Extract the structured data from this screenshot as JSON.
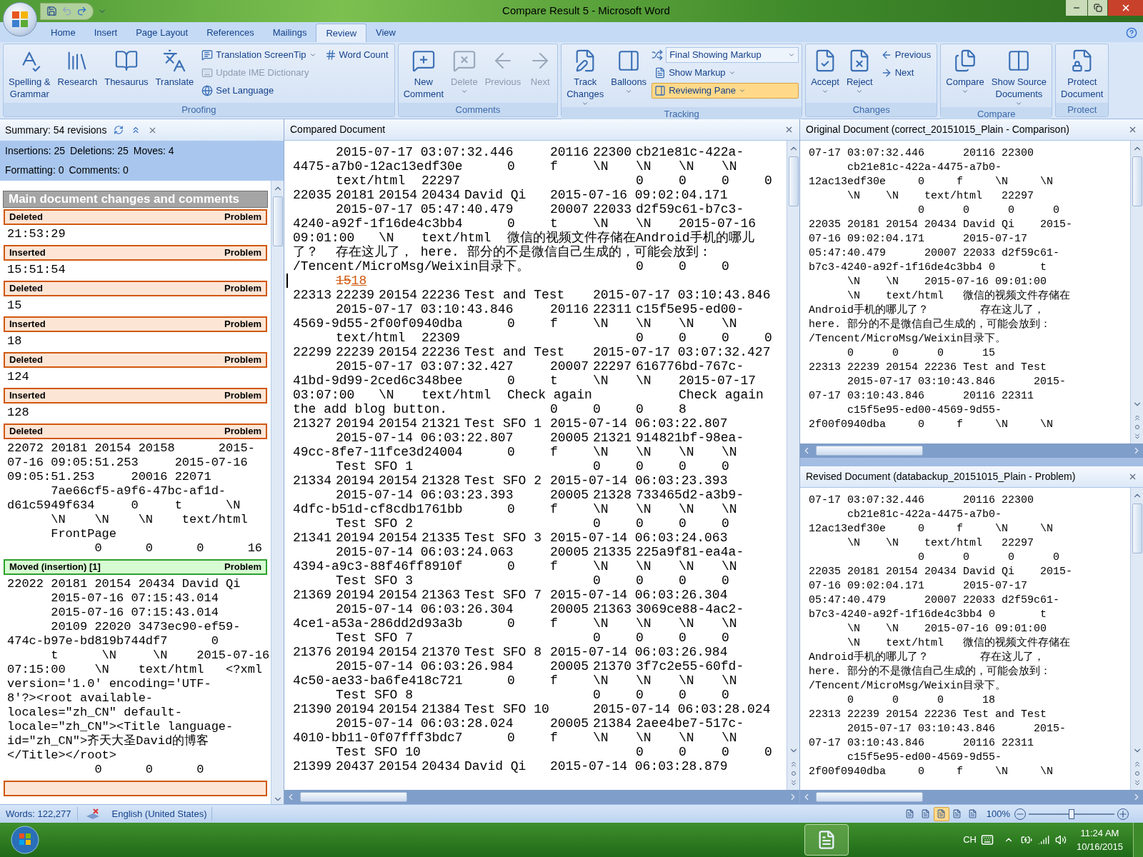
{
  "window": {
    "title": "Compare Result 5 - Microsoft Word"
  },
  "ribbon_tabs": [
    {
      "label": "Home",
      "selected": false
    },
    {
      "label": "Insert",
      "selected": false
    },
    {
      "label": "Page Layout",
      "selected": false
    },
    {
      "label": "References",
      "selected": false
    },
    {
      "label": "Mailings",
      "selected": false
    },
    {
      "label": "Review",
      "selected": true
    },
    {
      "label": "View",
      "selected": false
    }
  ],
  "ribbon_groups": [
    {
      "label": "Proofing",
      "controls": [
        {
          "kind": "large",
          "lines": [
            "Spelling &",
            "Grammar"
          ],
          "menu": false,
          "disabled": false
        },
        {
          "kind": "large",
          "lines": [
            "Research"
          ],
          "menu": false,
          "disabled": false
        },
        {
          "kind": "large",
          "lines": [
            "Thesaurus"
          ],
          "menu": false,
          "disabled": false
        },
        {
          "kind": "large",
          "lines": [
            "Translate"
          ],
          "menu": false,
          "disabled": false
        },
        {
          "kind": "stack",
          "items": [
            {
              "kind": "button",
              "label": "Translation ScreenTip",
              "menu": true,
              "disabled": false,
              "pressed": false
            },
            {
              "kind": "button",
              "label": "Update IME Dictionary",
              "menu": false,
              "disabled": true,
              "pressed": false
            },
            {
              "kind": "button",
              "label": "Set Language",
              "menu": false,
              "disabled": false,
              "pressed": false
            }
          ]
        },
        {
          "kind": "stack",
          "items": [
            {
              "kind": "button",
              "label": "Word Count",
              "menu": false,
              "disabled": false,
              "pressed": false
            }
          ]
        }
      ]
    },
    {
      "label": "Comments",
      "controls": [
        {
          "kind": "large",
          "lines": [
            "New",
            "Comment"
          ],
          "menu": false,
          "disabled": false
        },
        {
          "kind": "large",
          "lines": [
            "Delete"
          ],
          "menu": true,
          "disabled": true
        },
        {
          "kind": "large",
          "lines": [
            "Previous"
          ],
          "menu": false,
          "disabled": true
        },
        {
          "kind": "large",
          "lines": [
            "Next"
          ],
          "menu": false,
          "disabled": true
        }
      ]
    },
    {
      "label": "Tracking",
      "controls": [
        {
          "kind": "large",
          "lines": [
            "Track",
            "Changes"
          ],
          "menu": true,
          "disabled": false
        },
        {
          "kind": "large",
          "lines": [
            "Balloons"
          ],
          "menu": true,
          "disabled": false
        },
        {
          "kind": "stack",
          "items": [
            {
              "kind": "combo",
              "label": "Final Showing Markup",
              "menu": true,
              "disabled": false,
              "pressed": false
            },
            {
              "kind": "button",
              "label": "Show Markup",
              "menu": true,
              "disabled": false,
              "pressed": false
            },
            {
              "kind": "button",
              "label": "Reviewing Pane",
              "menu": true,
              "disabled": false,
              "pressed": true
            }
          ]
        }
      ]
    },
    {
      "label": "Changes",
      "controls": [
        {
          "kind": "large",
          "lines": [
            "Accept"
          ],
          "menu": true,
          "disabled": false
        },
        {
          "kind": "large",
          "lines": [
            "Reject"
          ],
          "menu": true,
          "disabled": false
        },
        {
          "kind": "stack",
          "items": [
            {
              "kind": "button",
              "label": "Previous",
              "menu": false,
              "disabled": false,
              "pressed": false
            },
            {
              "kind": "button",
              "label": "Next",
              "menu": false,
              "disabled": false,
              "pressed": false
            }
          ]
        }
      ]
    },
    {
      "label": "Compare",
      "controls": [
        {
          "kind": "large",
          "lines": [
            "Compare"
          ],
          "menu": true,
          "disabled": false
        },
        {
          "kind": "large",
          "lines": [
            "Show Source",
            "Documents"
          ],
          "menu": true,
          "disabled": false
        }
      ]
    },
    {
      "label": "Protect",
      "controls": [
        {
          "kind": "large",
          "lines": [
            "Protect",
            "Document"
          ],
          "menu": false,
          "disabled": false
        }
      ]
    }
  ],
  "reviewing_pane": {
    "summary": "Summary: 54 revisions",
    "counts": [
      [
        "Insertions: 25",
        "Deletions: 25",
        "Moves: 4"
      ],
      [
        "Formatting: 0",
        "Comments: 0"
      ]
    ],
    "section_heading": "Main document changes and comments",
    "revisions": [
      {
        "kind": "deleted",
        "label": "Deleted",
        "author": "Problem",
        "lines": [
          "21:53:29"
        ]
      },
      {
        "kind": "inserted",
        "label": "Inserted",
        "author": "Problem",
        "lines": [
          "15:51:54"
        ]
      },
      {
        "kind": "deleted",
        "label": "Deleted",
        "author": "Problem",
        "lines": [
          "15"
        ]
      },
      {
        "kind": "inserted",
        "label": "Inserted",
        "author": "Problem",
        "lines": [
          "18"
        ]
      },
      {
        "kind": "deleted",
        "label": "Deleted",
        "author": "Problem",
        "lines": [
          "124"
        ]
      },
      {
        "kind": "inserted",
        "label": "Inserted",
        "author": "Problem",
        "lines": [
          "128"
        ]
      },
      {
        "kind": "deleted",
        "label": "Deleted",
        "author": "Problem",
        "lines": [
          "22072 20181 20154 20158      2015-",
          "07-16 09:05:51.253     2015-07-16",
          "09:05:51.253     20016 22071",
          "      7ae66cf5-a9f6-47bc-af1d-",
          "d61c5949f634     0     t      \\N",
          "      \\N    \\N    \\N    text/html",
          "      FrontPage",
          "            0      0      0      16"
        ]
      },
      {
        "kind": "moved",
        "label": "Moved (insertion) [1]",
        "author": "Problem",
        "lines": [
          "22022 20181 20154 20434 David Qi",
          "      2015-07-16 07:15:43.014",
          "      2015-07-16 07:15:43.014",
          "      20109 22020 3473ec90-ef59-",
          "474c-b97e-bd819b744df7      0",
          "      t      \\N     \\N    2015-07-16",
          "07:15:00    \\N    text/html   <?xml",
          "version='1.0' encoding='UTF-",
          "8'?><root available-",
          "locales=\"zh_CN\" default-",
          "locale=\"zh_CN\"><Title language-",
          "id=\"zh_CN\">齐天大圣David的博客",
          "</Title></root>",
          "            0      0      0"
        ]
      },
      {
        "kind": "inserted"
      }
    ]
  },
  "compared_document": {
    "title": "Compared Document",
    "lines": [
      {
        "kind": "text",
        "text": "\t2015-07-17 03:07:32.446\t20116\t22300\tcb21e81c-422a-"
      },
      {
        "kind": "text",
        "text": "4475-a7b0-12ac13edf30e\t0\tf\t\\N\t\\N\t\\N\t\\N"
      },
      {
        "kind": "text",
        "text": "\ttext/html\t22297\t\t\t\t\t0\t0\t0\t0"
      },
      {
        "kind": "text",
        "text": "22035\t20181\t20154\t20434\tDavid Qi\t2015-07-16 09:02:04.171"
      },
      {
        "kind": "text",
        "text": "\t2015-07-17 05:47:40.479\t20007\t22033\td2f59c61-b7c3-"
      },
      {
        "kind": "text",
        "text": "4240-a92f-1f16de4c3bb4\t0\tt\t\\N\t\\N\t2015-07-16"
      },
      {
        "kind": "text",
        "text": "09:01:00\t\\N\ttext/html\t微信的视频文件存储在Android手机的哪儿"
      },
      {
        "kind": "text",
        "text": "了？\t存在这儿了， here. 部分的不是微信自己生成的，可能会放到："
      },
      {
        "kind": "text",
        "text": "/Tencent/MicroMsg/Weixin目录下。\t\t\t0\t0\t0"
      },
      {
        "kind": "revision",
        "deleted": "15",
        "inserted": "18"
      },
      {
        "kind": "text",
        "text": "22313\t22239\t20154\t22236\tTest and Test\t2015-07-17 03:10:43.846"
      },
      {
        "kind": "text",
        "text": "\t2015-07-17 03:10:43.846\t20116\t22311\tc15f5e95-ed00-"
      },
      {
        "kind": "text",
        "text": "4569-9d55-2f00f0940dba\t0\tf\t\\N\t\\N\t\\N\t\\N"
      },
      {
        "kind": "text",
        "text": "\ttext/html\t22309\t\t\t\t\t0\t0\t0\t0"
      },
      {
        "kind": "text",
        "text": "22299\t22239\t20154\t22236\tTest and Test\t2015-07-17 03:07:32.427"
      },
      {
        "kind": "text",
        "text": "\t2015-07-17 03:07:32.427\t20007\t22297\t616776bd-767c-"
      },
      {
        "kind": "text",
        "text": "41bd-9d99-2ced6c348bee\t0\tt\t\\N\t\\N\t2015-07-17"
      },
      {
        "kind": "text",
        "text": "03:07:00\t\\N\ttext/html\tCheck again\t\tCheck again"
      },
      {
        "kind": "text",
        "text": "the add blog button.\t\t\t0\t0\t0\t8"
      },
      {
        "kind": "text",
        "text": "21327\t20194\t20154\t21321\tTest SFO 1\t2015-07-14 06:03:22.807"
      },
      {
        "kind": "text",
        "text": "\t2015-07-14 06:03:22.807\t20005\t21321\t914821bf-98ea-"
      },
      {
        "kind": "text",
        "text": "49cc-8fe7-11fce3d24004\t0\tf\t\\N\t\\N\t\\N\t\\N"
      },
      {
        "kind": "text",
        "text": "\tTest SFO 1\t\t\t\t\t0\t0\t0\t0"
      },
      {
        "kind": "text",
        "text": "21334\t20194\t20154\t21328\tTest SFO 2\t2015-07-14 06:03:23.393"
      },
      {
        "kind": "text",
        "text": "\t2015-07-14 06:03:23.393\t20005\t21328\t733465d2-a3b9-"
      },
      {
        "kind": "text",
        "text": "4dfc-b51d-cf8cdb1761bb\t0\tf\t\\N\t\\N\t\\N\t\\N"
      },
      {
        "kind": "text",
        "text": "\tTest SFO 2\t\t\t\t\t0\t0\t0\t0"
      },
      {
        "kind": "text",
        "text": "21341\t20194\t20154\t21335\tTest SFO 3\t2015-07-14 06:03:24.063"
      },
      {
        "kind": "text",
        "text": "\t2015-07-14 06:03:24.063\t20005\t21335\t225a9f81-ea4a-"
      },
      {
        "kind": "text",
        "text": "4394-a9c3-88f46ff8910f\t0\tf\t\\N\t\\N\t\\N\t\\N"
      },
      {
        "kind": "text",
        "text": "\tTest SFO 3\t\t\t\t\t0\t0\t0\t0"
      },
      {
        "kind": "text",
        "text": "21369\t20194\t20154\t21363\tTest SFO 7\t2015-07-14 06:03:26.304"
      },
      {
        "kind": "text",
        "text": "\t2015-07-14 06:03:26.304\t20005\t21363\t3069ce88-4ac2-"
      },
      {
        "kind": "text",
        "text": "4ce1-a53a-286dd2d93a3b\t0\tf\t\\N\t\\N\t\\N\t\\N"
      },
      {
        "kind": "text",
        "text": "\tTest SFO 7\t\t\t\t\t0\t0\t0\t0"
      },
      {
        "kind": "text",
        "text": "21376\t20194\t20154\t21370\tTest SFO 8\t2015-07-14 06:03:26.984"
      },
      {
        "kind": "text",
        "text": "\t2015-07-14 06:03:26.984\t20005\t21370\t3f7c2e55-60fd-"
      },
      {
        "kind": "text",
        "text": "4c50-ae33-ba6fe418c721\t0\tf\t\\N\t\\N\t\\N\t\\N"
      },
      {
        "kind": "text",
        "text": "\tTest SFO 8\t\t\t\t\t0\t0\t0\t0"
      },
      {
        "kind": "text",
        "text": "21390\t20194\t20154\t21384\tTest SFO 10\t2015-07-14 06:03:28.024"
      },
      {
        "kind": "text",
        "text": "\t2015-07-14 06:03:28.024\t20005\t21384\t2aee4be7-517c-"
      },
      {
        "kind": "text",
        "text": "4010-bb11-0f07fff3bdc7\t0\tf\t\\N\t\\N\t\\N\t\\N"
      },
      {
        "kind": "text",
        "text": "\tTest SFO 10\t\t\t\t\t0\t0\t0\t0"
      },
      {
        "kind": "text",
        "text": "21399\t20437\t20154\t20434\tDavid Qi\t2015-07-14 06:03:28.879"
      }
    ]
  },
  "source_documents": [
    {
      "title": "Original Document (correct_20151015_Plain - Comparison)",
      "lines": [
        "07-17 03:07:32.446      20116 22300",
        "      cb21e81c-422a-4475-a7b0-",
        "12ac13edf30e     0     f     \\N     \\N",
        "      \\N    \\N    text/html   22297",
        "                 0      0      0      0",
        "22035 20181 20154 20434 David Qi    2015-",
        "07-16 09:02:04.171      2015-07-17",
        "05:47:40.479      20007 22033 d2f59c61-",
        "b7c3-4240-a92f-1f16de4c3bb4 0       t",
        "      \\N    \\N    2015-07-16 09:01:00",
        "      \\N    text/html   微信的视频文件存储在",
        "Android手机的哪儿了？        存在这儿了，",
        "here. 部分的不是微信自己生成的，可能会放到：",
        "/Tencent/MicroMsg/Weixin目录下。",
        "      0      0      0      15",
        "22313 22239 20154 22236 Test and Test",
        "      2015-07-17 03:10:43.846      2015-",
        "07-17 03:10:43.846      20116 22311",
        "      c15f5e95-ed00-4569-9d55-",
        "2f00f0940dba     0     f     \\N     \\N"
      ]
    },
    {
      "title": "Revised Document (databackup_20151015_Plain - Problem)",
      "lines": [
        "07-17 03:07:32.446      20116 22300",
        "      cb21e81c-422a-4475-a7b0-",
        "12ac13edf30e     0     f     \\N     \\N",
        "      \\N    \\N    text/html   22297",
        "                 0      0      0      0",
        "22035 20181 20154 20434 David Qi    2015-",
        "07-16 09:02:04.171      2015-07-17",
        "05:47:40.479      20007 22033 d2f59c61-",
        "b7c3-4240-a92f-1f16de4c3bb4 0       t",
        "      \\N    \\N    2015-07-16 09:01:00",
        "      \\N    text/html   微信的视频文件存储在",
        "Android手机的哪儿了？        存在这儿了，",
        "here. 部分的不是微信自己生成的，可能会放到：",
        "/Tencent/MicroMsg/Weixin目录下。",
        "      0      0      0      18",
        "22313 22239 20154 22236 Test and Test",
        "      2015-07-17 03:10:43.846      2015-",
        "07-17 03:10:43.846      20116 22311",
        "      c15f5e95-ed00-4569-9d55-",
        "2f00f0940dba     0     f     \\N     \\N"
      ]
    }
  ],
  "status_bar": {
    "words": "Words: 122,277",
    "language": "English (United States)",
    "views": [
      {
        "selected": false
      },
      {
        "selected": false
      },
      {
        "selected": true
      },
      {
        "selected": false
      },
      {
        "selected": false
      }
    ],
    "zoom": "100%",
    "level": 0.5
  },
  "taskbar": {
    "input_language": "CH",
    "time": "11:24 AM",
    "date": "10/16/2015"
  }
}
